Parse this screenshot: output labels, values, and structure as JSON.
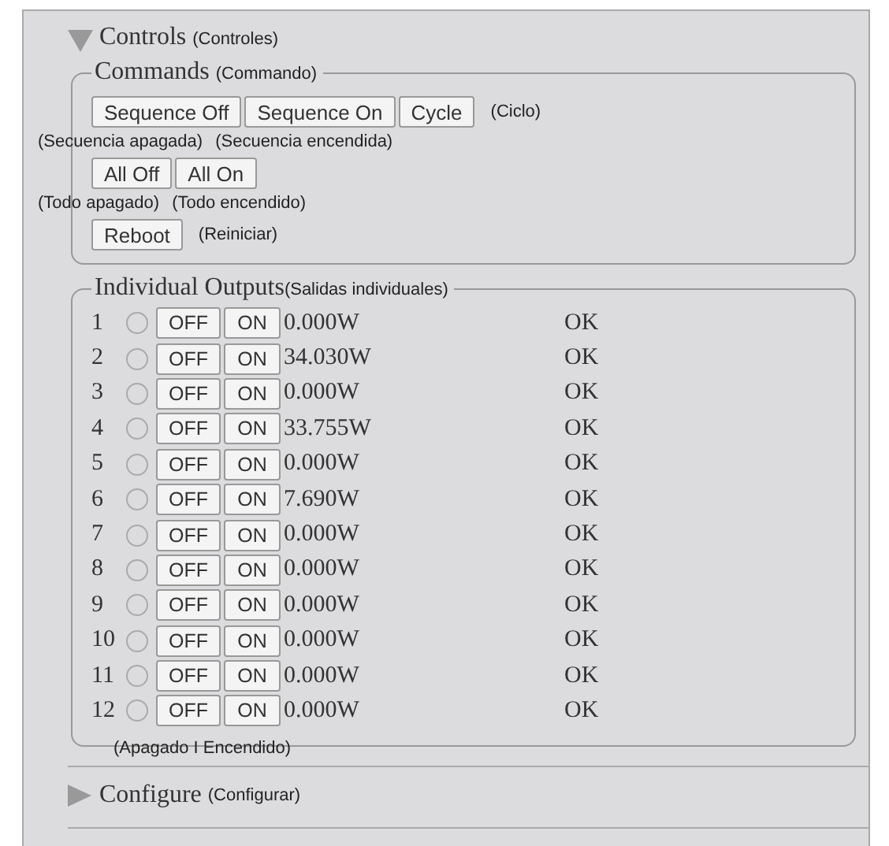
{
  "controls": {
    "title": "Controls",
    "note": "(Controles)",
    "expanded": true
  },
  "commands": {
    "legend": "Commands",
    "note": "(Commando)",
    "rows": [
      {
        "buttons": [
          "Sequence Off",
          "Sequence On",
          "Cycle"
        ],
        "side_note": "(Ciclo)",
        "notes_below": [
          "(Secuencia apagada)",
          "(Secuencia encendida)"
        ]
      },
      {
        "buttons": [
          "All Off",
          "All On"
        ],
        "notes_below": [
          "(Todo apagado)",
          "(Todo encendido)"
        ]
      },
      {
        "buttons": [
          "Reboot"
        ],
        "side_note": "(Reiniciar)"
      }
    ]
  },
  "outputs": {
    "legend": "Individual Outputs",
    "note": "(Salidas individuales)",
    "footer_note": "(Apagado I Encendido)",
    "rows": [
      {
        "number": "1",
        "lit": false,
        "off_label": "OFF",
        "on_label": "ON",
        "power": "0.000W",
        "status": "OK"
      },
      {
        "number": "2",
        "lit": false,
        "off_label": "OFF",
        "on_label": "ON",
        "power": "34.030W",
        "status": "OK"
      },
      {
        "number": "3",
        "lit": false,
        "off_label": "OFF",
        "on_label": "ON",
        "power": "0.000W",
        "status": "OK"
      },
      {
        "number": "4",
        "lit": false,
        "off_label": "OFF",
        "on_label": "ON",
        "power": "33.755W",
        "status": "OK"
      },
      {
        "number": "5",
        "lit": false,
        "off_label": "OFF",
        "on_label": "ON",
        "power": "0.000W",
        "status": "OK"
      },
      {
        "number": "6",
        "lit": false,
        "off_label": "OFF",
        "on_label": "ON",
        "power": "7.690W",
        "status": "OK"
      },
      {
        "number": "7",
        "lit": false,
        "off_label": "OFF",
        "on_label": "ON",
        "power": "0.000W",
        "status": "OK"
      },
      {
        "number": "8",
        "lit": false,
        "off_label": "OFF",
        "on_label": "ON",
        "power": "0.000W",
        "status": "OK"
      },
      {
        "number": "9",
        "lit": false,
        "off_label": "OFF",
        "on_label": "ON",
        "power": "0.000W",
        "status": "OK"
      },
      {
        "number": "10",
        "lit": false,
        "off_label": "OFF",
        "on_label": "ON",
        "power": "0.000W",
        "status": "OK"
      },
      {
        "number": "11",
        "lit": false,
        "off_label": "OFF",
        "on_label": "ON",
        "power": "0.000W",
        "status": "OK"
      },
      {
        "number": "12",
        "lit": false,
        "off_label": "OFF",
        "on_label": "ON",
        "power": "0.000W",
        "status": "OK"
      }
    ]
  },
  "configure": {
    "title": "Configure",
    "note": "(Configurar)",
    "expanded": false
  }
}
